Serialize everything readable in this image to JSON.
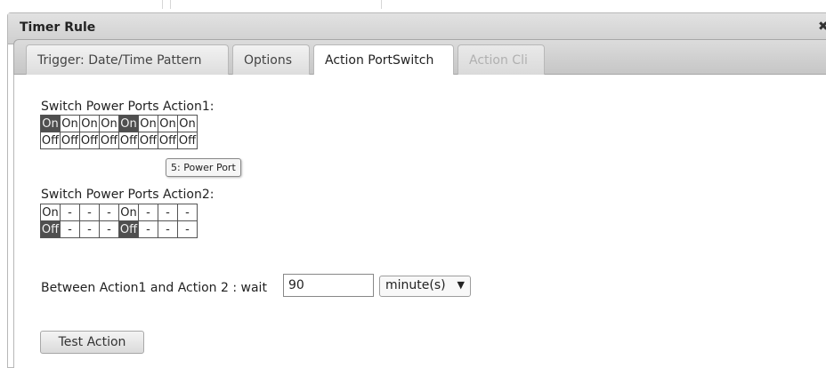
{
  "dialog": {
    "title": "Timer Rule",
    "close_glyph": "✖"
  },
  "tabs": [
    {
      "label": "Trigger: Date/Time Pattern",
      "state": "normal"
    },
    {
      "label": "Options",
      "state": "normal"
    },
    {
      "label": "Action PortSwitch",
      "state": "active"
    },
    {
      "label": "Action Cli",
      "state": "disabled"
    }
  ],
  "action1": {
    "label": "Switch Power Ports Action1:",
    "on_row": [
      "On",
      "On",
      "On",
      "On",
      "On",
      "On",
      "On",
      "On"
    ],
    "off_row": [
      "Off",
      "Off",
      "Off",
      "Off",
      "Off",
      "Off",
      "Off",
      "Off"
    ],
    "on_selected": [
      true,
      false,
      false,
      false,
      true,
      false,
      false,
      false
    ],
    "off_selected": [
      false,
      false,
      false,
      false,
      false,
      false,
      false,
      false
    ]
  },
  "tooltip": {
    "text": "5: Power Port"
  },
  "action2": {
    "label": "Switch Power Ports Action2:",
    "on_row": [
      "On",
      "-",
      "-",
      "-",
      "On",
      "-",
      "-",
      "-"
    ],
    "off_row": [
      "Off",
      "-",
      "-",
      "-",
      "Off",
      "-",
      "-",
      "-"
    ],
    "on_selected": [
      false,
      false,
      false,
      false,
      false,
      false,
      false,
      false
    ],
    "off_selected": [
      true,
      false,
      false,
      false,
      true,
      false,
      false,
      false
    ]
  },
  "wait": {
    "label": "Between Action1 and Action 2 : wait",
    "value": "90",
    "unit": "minute(s)",
    "caret": "▼"
  },
  "test_button": {
    "label": "Test Action"
  },
  "colors": {
    "selected_cell": "#4f4f4f",
    "titlebar": "#d6d6d6"
  }
}
